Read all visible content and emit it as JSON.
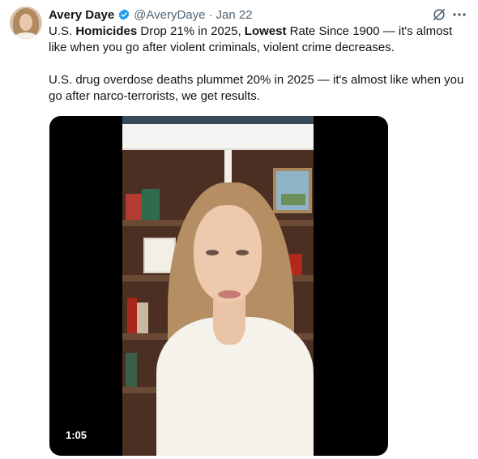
{
  "author": {
    "name": "Avery Daye",
    "handle": "@AveryDaye",
    "separator": "·",
    "date": "Jan 22",
    "verified_color": "#1d9bf0"
  },
  "tweet": {
    "p1": {
      "t1": "U.S. ",
      "b1": "Homicides",
      "t2": " Drop 21% in 2025, ",
      "b2": "Lowest",
      "t3": " Rate Since 1900 — it's almost like when you go after violent criminals, violent crime decreases."
    },
    "p2": "U.S. drug overdose deaths plummet 20% in 2025 — it's almost like when you go after narco-terrorists, we get results."
  },
  "media": {
    "duration": "1:05"
  },
  "icons": {
    "grok": "grok-icon",
    "more": "more-icon",
    "verified": "verified-badge-icon"
  }
}
